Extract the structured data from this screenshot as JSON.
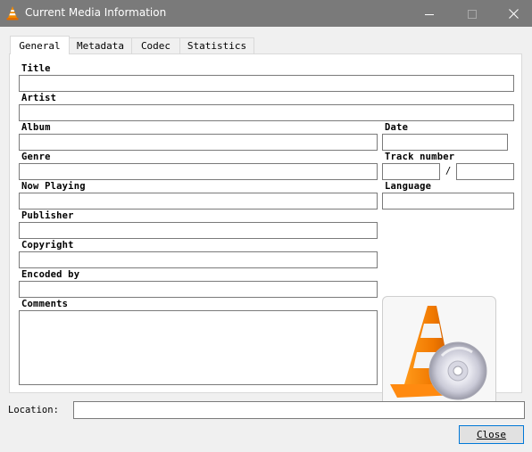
{
  "window": {
    "title": "Current Media Information",
    "icon": "vlc-cone-icon",
    "controls": [
      "minimize",
      "maximize",
      "close"
    ]
  },
  "tabs": [
    {
      "label": "General",
      "active": true
    },
    {
      "label": "Metadata",
      "active": false
    },
    {
      "label": "Codec",
      "active": false
    },
    {
      "label": "Statistics",
      "active": false
    }
  ],
  "fields": {
    "title": {
      "label": "Title",
      "value": ""
    },
    "artist": {
      "label": "Artist",
      "value": ""
    },
    "album": {
      "label": "Album",
      "value": ""
    },
    "date": {
      "label": "Date",
      "value": ""
    },
    "genre": {
      "label": "Genre",
      "value": ""
    },
    "track_number": {
      "label": "Track number",
      "value": "",
      "total": "",
      "separator": "/"
    },
    "now_playing": {
      "label": "Now Playing",
      "value": ""
    },
    "language": {
      "label": "Language",
      "value": ""
    },
    "publisher": {
      "label": "Publisher",
      "value": ""
    },
    "copyright": {
      "label": "Copyright",
      "value": ""
    },
    "encoded_by": {
      "label": "Encoded by",
      "value": ""
    },
    "comments": {
      "label": "Comments",
      "value": ""
    }
  },
  "artwork": {
    "icon": "vlc-cone-with-disc-icon"
  },
  "location": {
    "label": "Location:",
    "value": ""
  },
  "buttons": {
    "close": "Close"
  }
}
